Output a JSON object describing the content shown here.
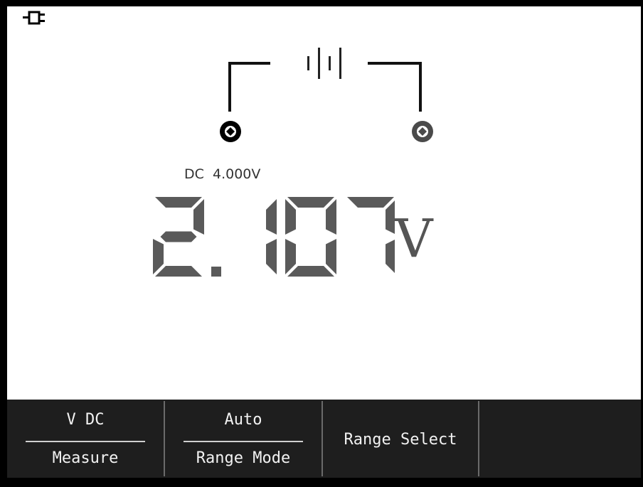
{
  "status": {
    "power_icon": "ac-plug-icon"
  },
  "circuit": {
    "source_icon": "dc-battery-symbol-icon",
    "left_probe": "black-terminal-icon",
    "right_probe": "grey-terminal-icon"
  },
  "measurement": {
    "range_label": "DC  4.000V",
    "value": "2.107",
    "unit": "V",
    "digit_color": "#5a5a5a"
  },
  "softkeys": [
    {
      "top": "V DC",
      "bottom": "Measure"
    },
    {
      "top": "Auto",
      "bottom": "Range Mode"
    },
    {
      "label": "Range Select"
    }
  ],
  "colors": {
    "background": "#000000",
    "screen": "#ffffff",
    "softkey_bar": "#1e1e1e",
    "softkey_text": "#f2f2f2"
  }
}
